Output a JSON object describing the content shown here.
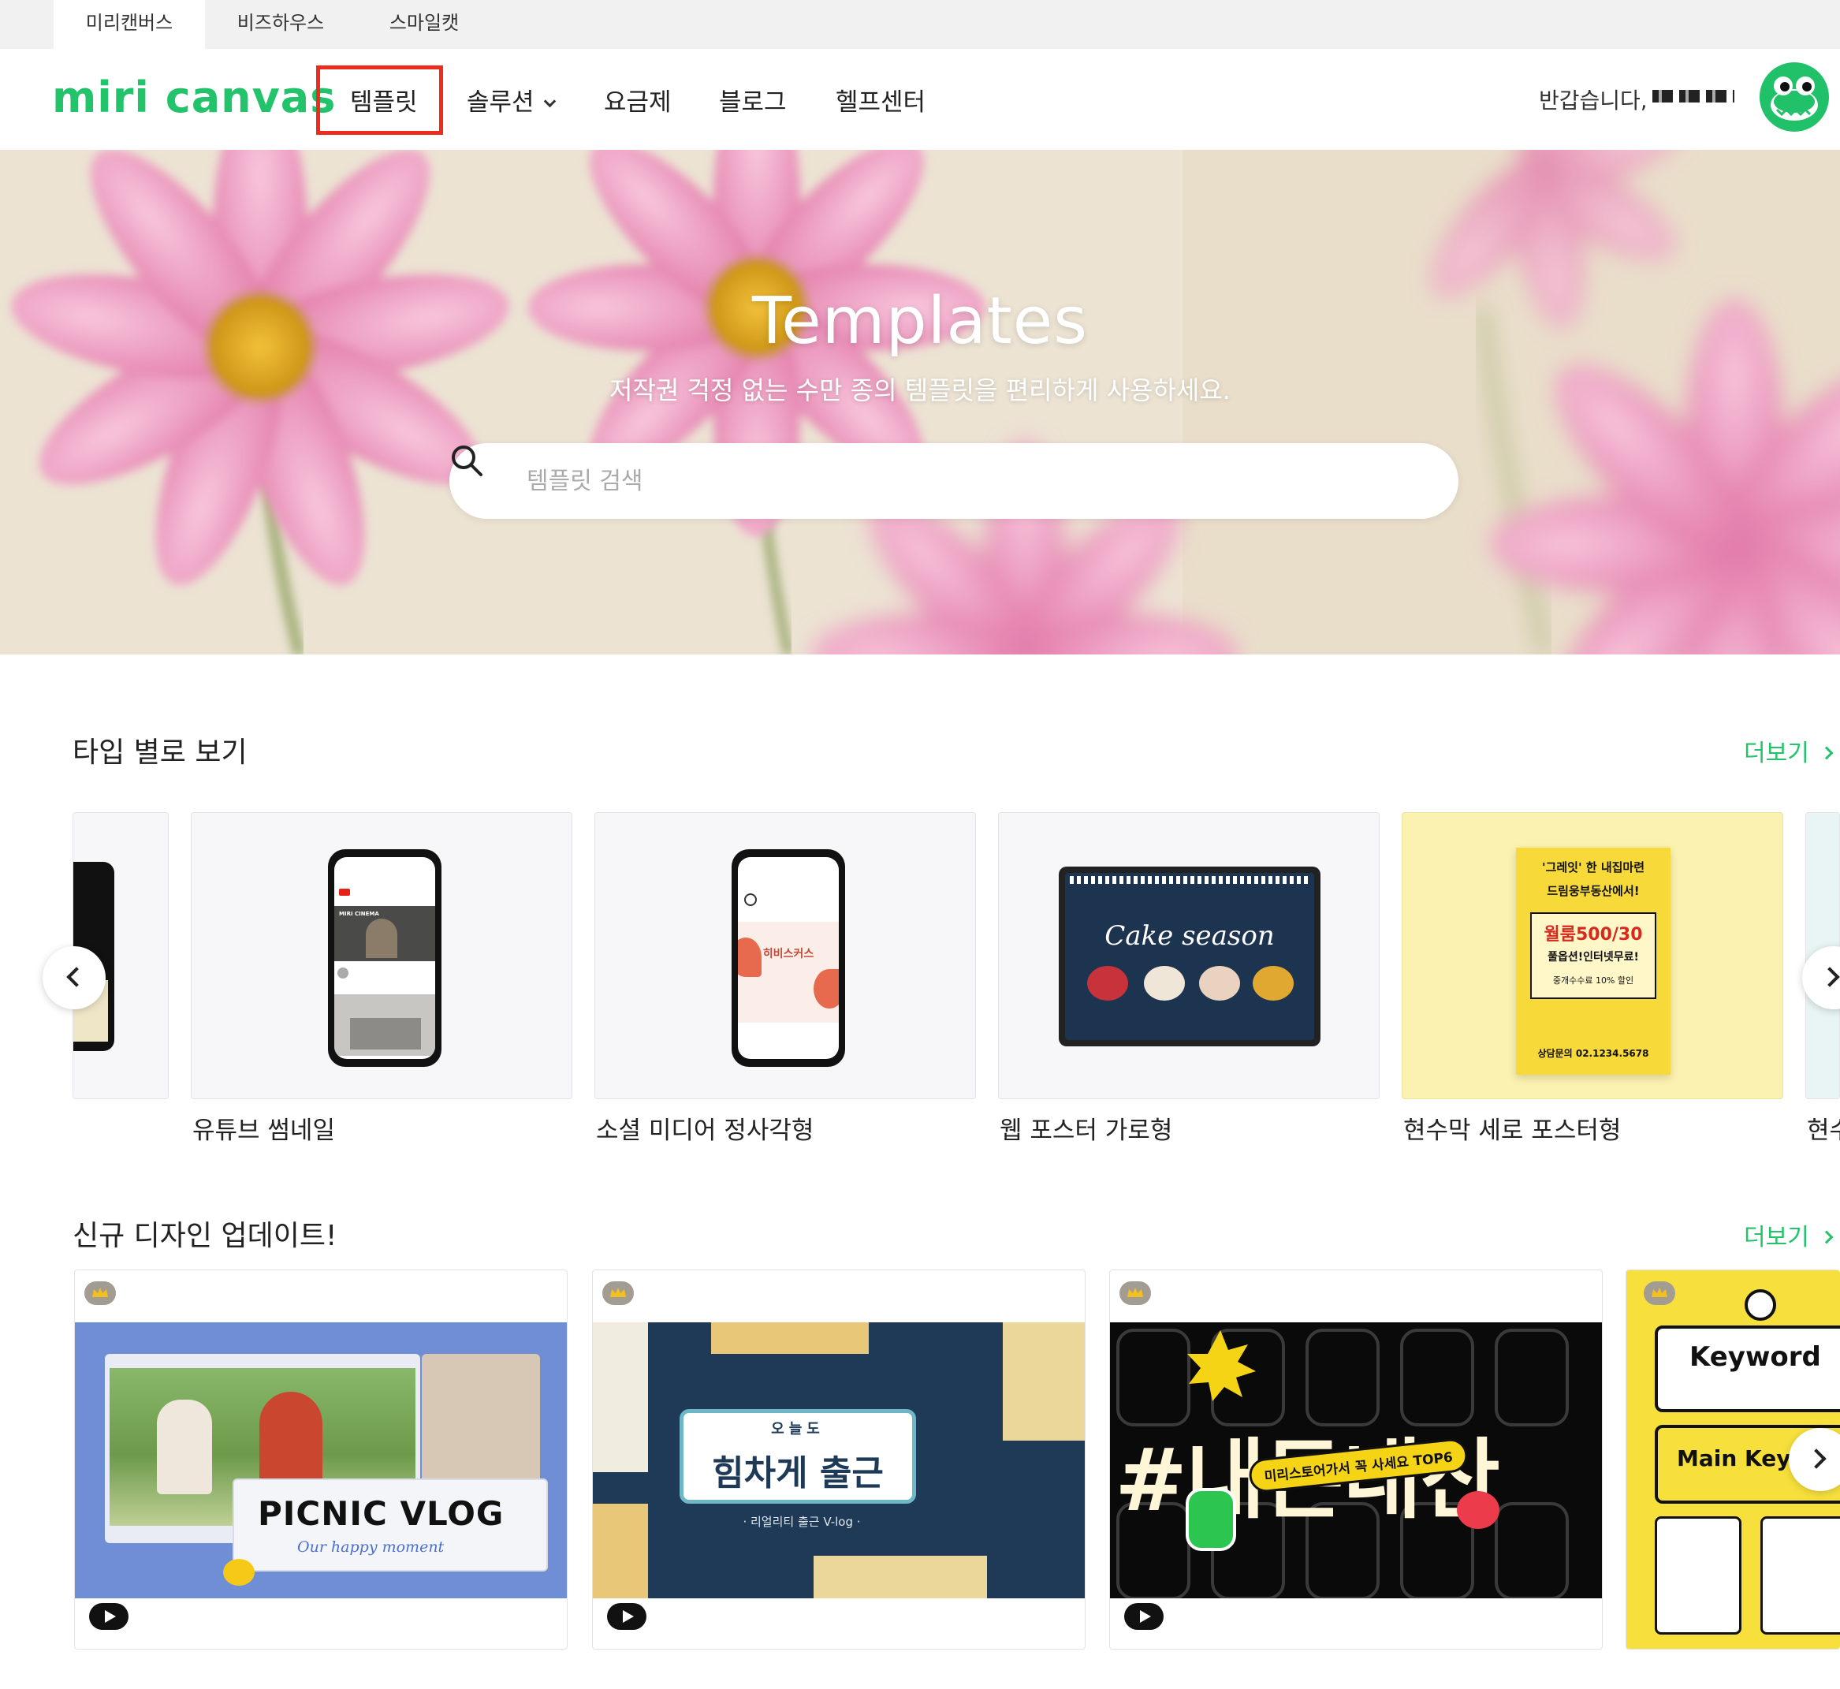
{
  "family_tabs": [
    "미리캔버스",
    "비즈하우스",
    "스마일캣"
  ],
  "header": {
    "logo": "miri canvas",
    "nav": {
      "templates": "템플릿",
      "solutions": "솔루션",
      "pricing": "요금제",
      "blog": "블로그",
      "help": "헬프센터"
    },
    "greeting": "반갑습니다,"
  },
  "hero": {
    "title": "Templates",
    "subtitle": "저작권 걱정 없는 수만 종의 템플릿을 편리하게 사용하세요.",
    "search_placeholder": "템플릿 검색"
  },
  "type_section": {
    "title": "타입 별로 보기",
    "more": "더보기",
    "cards": [
      {
        "label": "유튜브 썸네일"
      },
      {
        "label": "소셜 미디어 정사각형"
      },
      {
        "label": "웹 포스터 가로형"
      },
      {
        "label": "현수막 세로 포스터형"
      },
      {
        "label": "현수"
      }
    ]
  },
  "new_section": {
    "title": "신규 디자인 업데이트!",
    "more": "더보기",
    "cards": [
      {
        "headline": "PICNIC VLOG",
        "sub": "Our happy moment"
      },
      {
        "headline": "힘차게 출근",
        "tag": "오늘도",
        "sub": "· 리얼리티 출근 V-log ·"
      },
      {
        "headline": "#내돈내산",
        "sub": "미리스토어가서 꼭 사세요 TOP6"
      },
      {
        "headline": "Keyword",
        "sub": "Main Keyword"
      }
    ]
  },
  "thumb_text": {
    "cake": "Cake season",
    "hibiscus": "히비스커스",
    "banner_top": "'그레잇' 한 내집마련",
    "banner_mid": "드림웅부동산에서!",
    "banner_price": "월룸500/30",
    "banner_opt": "풀옵션!인터넷무료!",
    "banner_fee": "중개수수료 10% 할인",
    "banner_phone": "상담문의 02.1234.5678",
    "yt_channel": "MIRI CINEMA"
  },
  "colors": {
    "brand": "#22c36a",
    "highlight": "#ee2c1d",
    "banner_bg": "#fbf1b0",
    "vlog_bg": "#6f8ed6",
    "office_bg": "#1e3a57",
    "keyword_yellow": "#f7e03c"
  }
}
